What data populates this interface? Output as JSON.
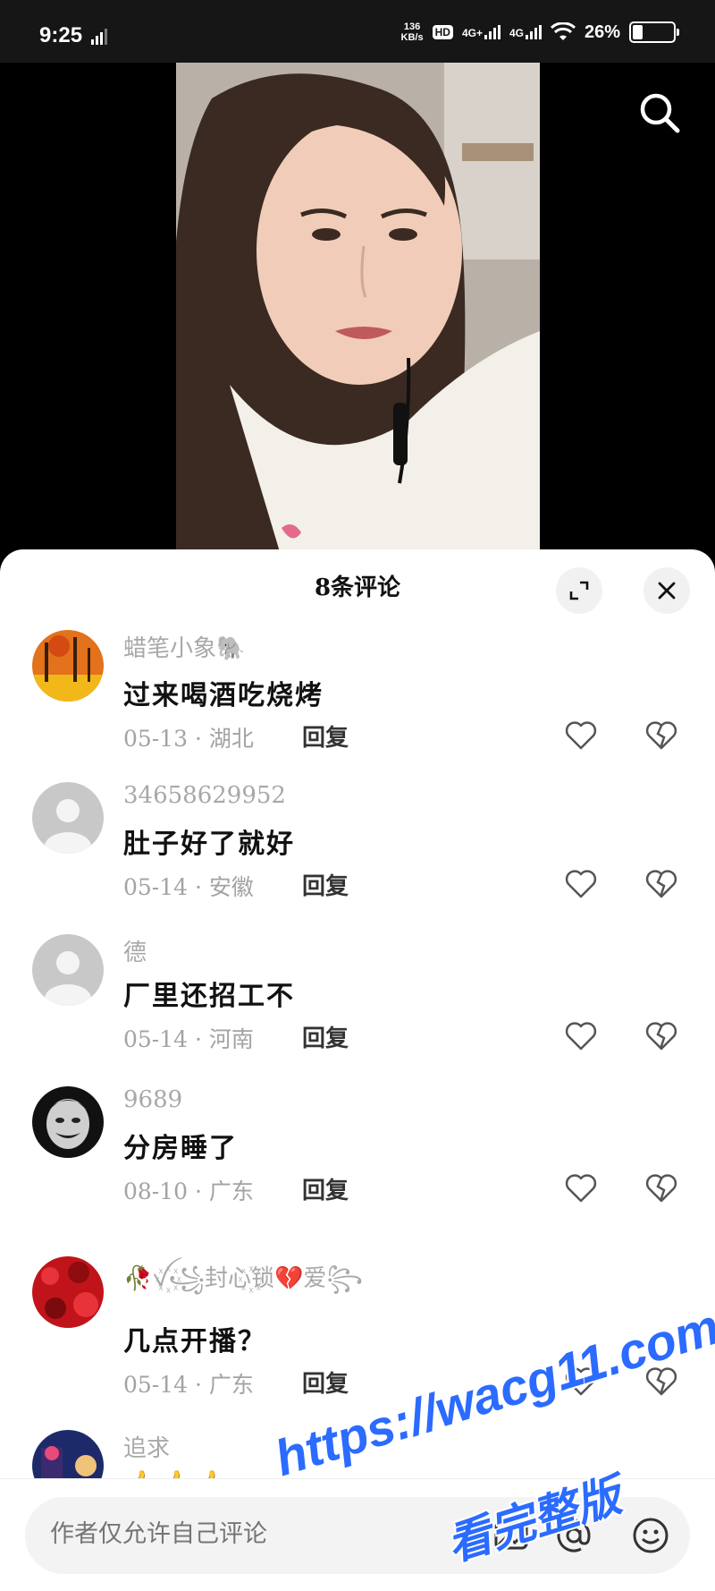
{
  "status_bar": {
    "time": "9:25",
    "net_speed_value": "136",
    "net_speed_unit": "KB/s",
    "hd_label": "HD",
    "hd_sub": "1 2",
    "net1": "4G+",
    "net2": "4G",
    "battery_pct": "26%",
    "battery_level": 0.26
  },
  "video": {
    "search_icon": "search-icon"
  },
  "sheet": {
    "title": "8条评论",
    "expand_icon": "expand-icon",
    "close_icon": "close-icon"
  },
  "comments": [
    {
      "user": "蜡笔小象🐘",
      "text": "过来喝酒吃烧烤",
      "date": "05-13",
      "location": "湖北",
      "reply": "回复",
      "avatar": "avatar-autumn",
      "avatar_color": "#e2721b"
    },
    {
      "user": "34658629952",
      "text": "肚子好了就好",
      "date": "05-14",
      "location": "安徽",
      "reply": "回复",
      "avatar": "avatar-default",
      "avatar_color": "#c8c8c8"
    },
    {
      "user": "德",
      "text": "厂里还招工不",
      "date": "05-14",
      "location": "河南",
      "reply": "回复",
      "avatar": "avatar-default",
      "avatar_color": "#c8c8c8"
    },
    {
      "user": "9689",
      "text": "分房睡了",
      "date": "08-10",
      "location": "广东",
      "reply": "回复",
      "avatar": "avatar-joker",
      "avatar_color": "#222222"
    },
    {
      "user": "🥀ꪜ꙰꧁封心꙰锁💔爱꧂",
      "text": "几点开播？",
      "date": "05-14",
      "location": "广东",
      "reply": "回复",
      "avatar": "avatar-red-flowers",
      "avatar_color": "#c0141a"
    },
    {
      "user": "追求",
      "text": "👍👍👍",
      "avatar": "avatar-night",
      "avatar_color": "#1d2a6a"
    }
  ],
  "input": {
    "placeholder": "作者仅允许自己评论",
    "icons": [
      "image-icon",
      "at-icon",
      "emoji-icon"
    ]
  },
  "watermark": {
    "url": "https://wacg11.com",
    "text": "看完整版"
  },
  "colors": {
    "link_watermark": "#2b6bff",
    "meta_gray": "#a3a3a3"
  }
}
